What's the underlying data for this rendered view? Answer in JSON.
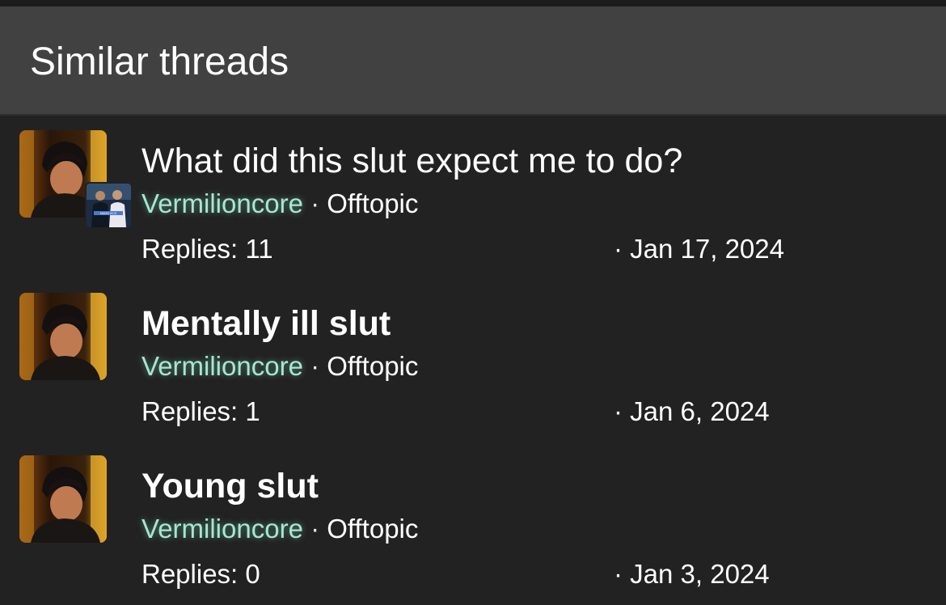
{
  "block": {
    "title": "Similar threads"
  },
  "threads": [
    {
      "title": "What did this slut expect me to do?",
      "title_bold": false,
      "author": "Vermilioncore",
      "separator": "·",
      "forum": "Offtopic",
      "replies": "Replies: 11",
      "date": "· Jan 17, 2024",
      "has_sub_avatar": true,
      "sub_avatar_text": "MIAMI VICE"
    },
    {
      "title": "Mentally ill slut",
      "title_bold": true,
      "author": "Vermilioncore",
      "separator": "·",
      "forum": "Offtopic",
      "replies": "Replies: 1",
      "date": "· Jan 6, 2024",
      "has_sub_avatar": false
    },
    {
      "title": "Young slut",
      "title_bold": true,
      "author": "Vermilioncore",
      "separator": "·",
      "forum": "Offtopic",
      "replies": "Replies: 0",
      "date": "· Jan 3, 2024",
      "has_sub_avatar": false
    }
  ],
  "colors": {
    "background": "#222222",
    "header_background": "#414141",
    "author_accent": "#a7e6cf"
  }
}
